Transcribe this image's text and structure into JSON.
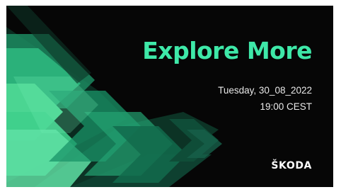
{
  "slide": {
    "headline": "Explore More",
    "date": "Tuesday, 30_08_2022",
    "time": "19:00 CEST",
    "brand_logo": "ŠKODA"
  },
  "colors": {
    "background": "#060606",
    "headline": "#3ee8a8",
    "accent_green": "#4bd592",
    "dark_green": "#0a3a2a",
    "text": "#e9e9e9"
  },
  "icons": {
    "artwork": "green-chevron-arrows-graphic"
  }
}
